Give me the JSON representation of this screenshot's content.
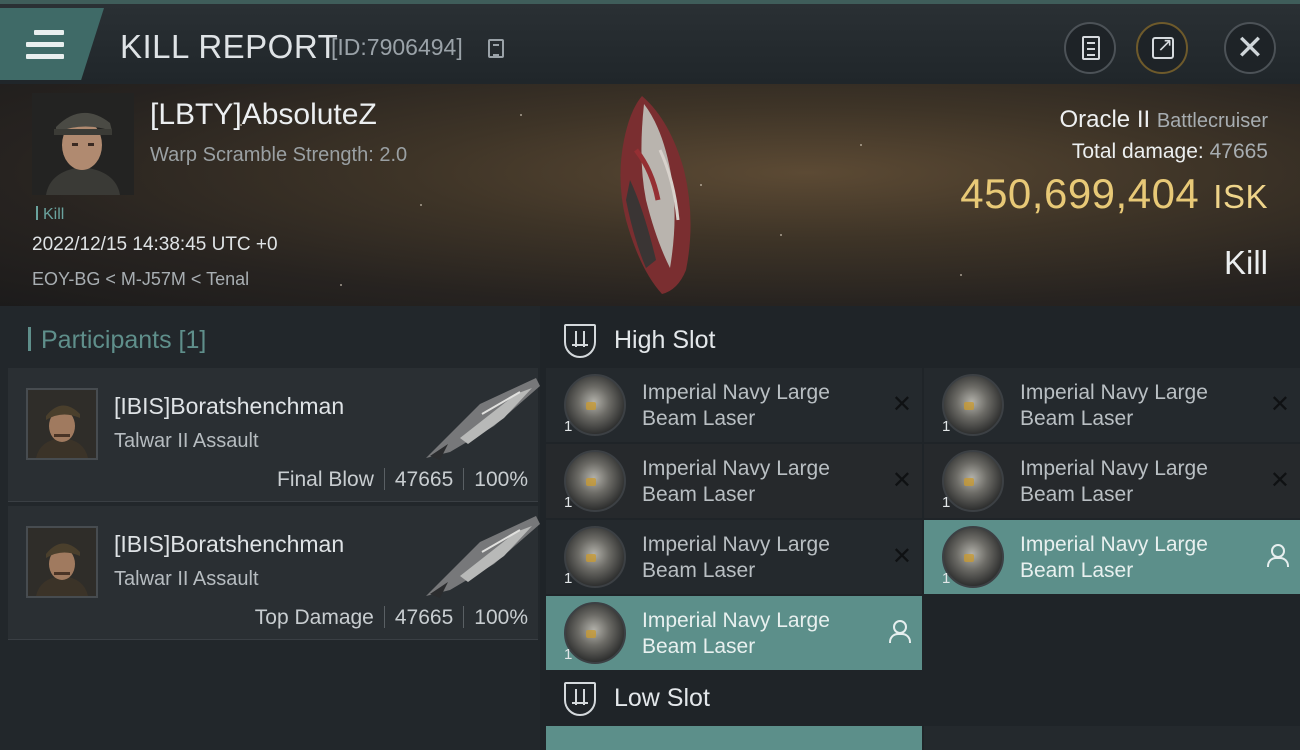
{
  "header": {
    "title": "KILL REPORT",
    "report_id": "[ID:7906494]",
    "icons": {
      "menu": "menu-icon",
      "copy": "copy-icon",
      "clipboard": "clipboard-icon",
      "share": "share-icon",
      "close": "close-icon"
    }
  },
  "victim": {
    "name": "[LBTY]AbsoluteZ",
    "warp_scramble": "Warp Scramble Strength: 2.0",
    "tag": "Kill",
    "time": "2022/12/15 14:38:45 UTC +0",
    "location": "EOY-BG < M-J57M < Tenal",
    "ship_name": "Oracle II",
    "ship_class": "Battlecruiser",
    "total_damage_label": "Total damage:",
    "total_damage_value": "47665",
    "isk_value": "450,699,404",
    "isk_unit": "ISK",
    "result": "Kill"
  },
  "participants": {
    "title": "Participants [1]",
    "rows": [
      {
        "name": "[IBIS]Boratshenchman",
        "ship": "Talwar II Assault",
        "role": "Final Blow",
        "damage": "47665",
        "percent": "100%"
      },
      {
        "name": "[IBIS]Boratshenchman",
        "ship": "Talwar II Assault",
        "role": "Top Damage",
        "damage": "47665",
        "percent": "100%"
      }
    ]
  },
  "slots": {
    "high": {
      "label": "High Slot",
      "modules": [
        {
          "name": "Imperial Navy Large Beam Laser",
          "qty": "1",
          "status": "destroyed"
        },
        {
          "name": "Imperial Navy Large Beam Laser",
          "qty": "1",
          "status": "destroyed"
        },
        {
          "name": "Imperial Navy Large Beam Laser",
          "qty": "1",
          "status": "destroyed"
        },
        {
          "name": "Imperial Navy Large Beam Laser",
          "qty": "1",
          "status": "destroyed"
        },
        {
          "name": "Imperial Navy Large Beam Laser",
          "qty": "1",
          "status": "destroyed"
        },
        {
          "name": "Imperial Navy Large Beam Laser",
          "qty": "1",
          "status": "dropped"
        },
        {
          "name": "Imperial Navy Large Beam Laser",
          "qty": "1",
          "status": "dropped"
        }
      ]
    },
    "low": {
      "label": "Low Slot"
    }
  },
  "colors": {
    "accent": "#5c8f8a",
    "isk": "#e8c977",
    "panel": "#22272b"
  }
}
